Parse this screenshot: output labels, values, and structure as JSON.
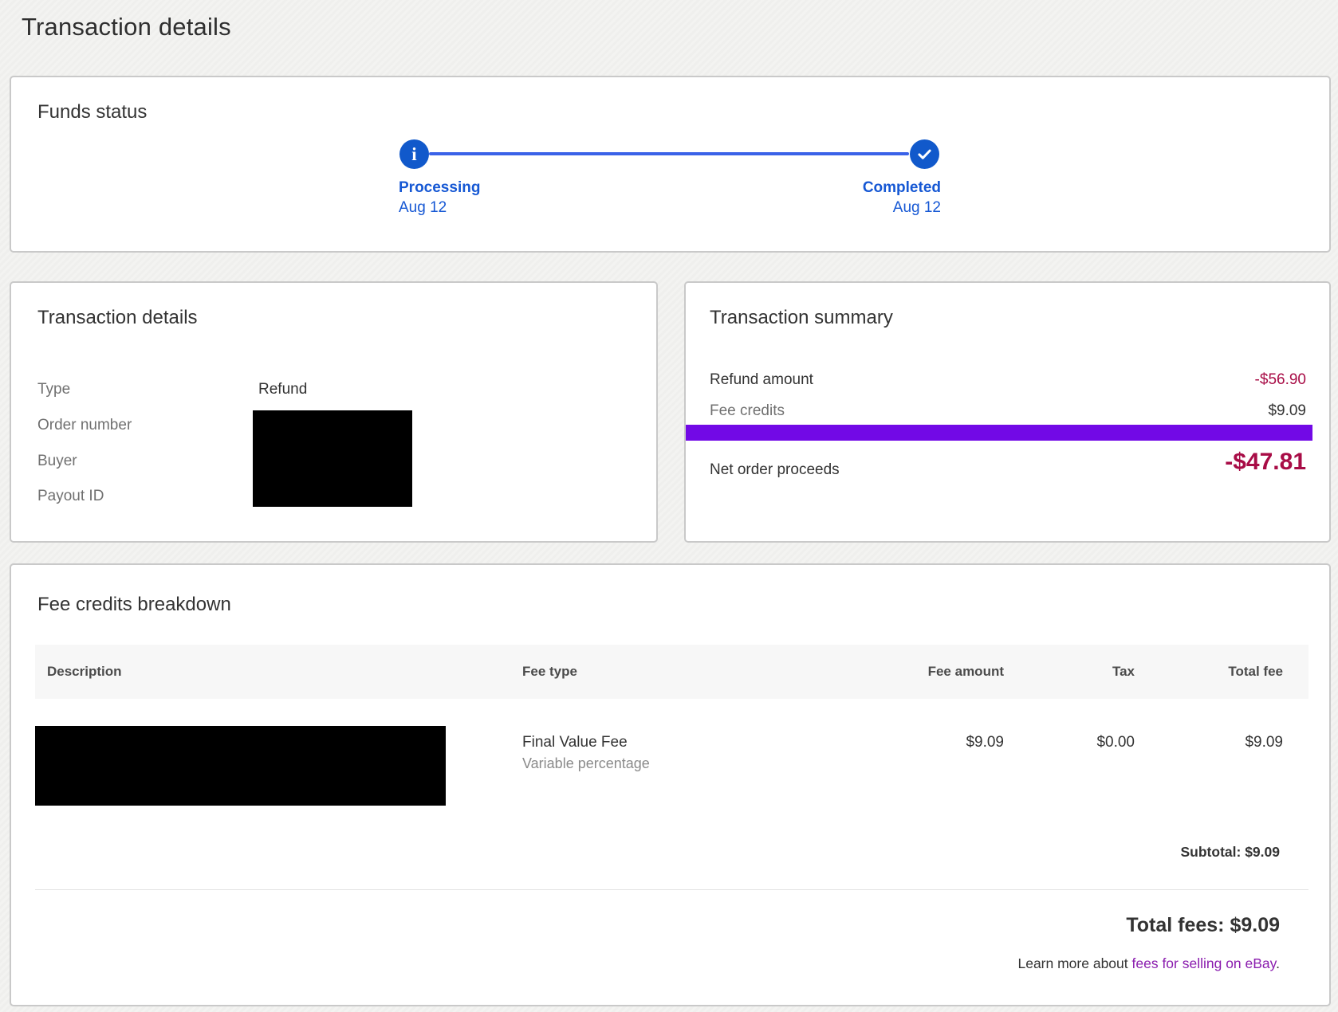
{
  "page": {
    "title": "Transaction details"
  },
  "funds_status": {
    "title": "Funds status",
    "steps": [
      {
        "label": "Processing",
        "date": "Aug 12",
        "icon": "info"
      },
      {
        "label": "Completed",
        "date": "Aug 12",
        "icon": "check"
      }
    ]
  },
  "transaction_details": {
    "title": "Transaction details",
    "rows": [
      {
        "label": "Type",
        "value": "Refund",
        "redacted": false
      },
      {
        "label": "Order number",
        "value": "",
        "redacted": true
      },
      {
        "label": "Buyer",
        "value": "",
        "redacted": true
      },
      {
        "label": "Payout ID",
        "value": "",
        "redacted": true
      }
    ]
  },
  "transaction_summary": {
    "title": "Transaction summary",
    "rows": [
      {
        "label": "Refund amount",
        "value": "-$56.90"
      },
      {
        "label": "Fee credits",
        "value": "$9.09"
      }
    ],
    "redacted_row": true,
    "net": {
      "label": "Net order proceeds",
      "value": "-$47.81"
    }
  },
  "fee_breakdown": {
    "title": "Fee credits breakdown",
    "columns": [
      "Description",
      "Fee type",
      "Fee amount",
      "Tax",
      "Total fee"
    ],
    "rows": [
      {
        "description_redacted": true,
        "fee_type": "Final Value Fee",
        "fee_subtype": "Variable percentage",
        "fee_amount": "$9.09",
        "tax": "$0.00",
        "total_fee": "$9.09"
      }
    ],
    "subtotal_label": "Subtotal:",
    "subtotal_value": "$9.09",
    "total_label": "Total fees:",
    "total_value": "$9.09",
    "footer_prefix": "Learn more about ",
    "footer_link": "fees for selling on eBay",
    "footer_suffix": "."
  },
  "colors": {
    "accent_blue": "#1159cb",
    "timeline_line_blue": "#3a62e8",
    "negative_amount_red": "#a80c46",
    "redaction_purple": "#7209e6",
    "link_purple": "#8a1cae",
    "page_background": "#f3f3f1"
  }
}
